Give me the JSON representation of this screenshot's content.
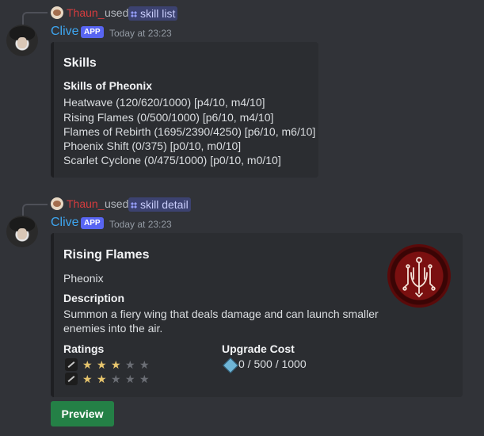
{
  "message1": {
    "reply": {
      "user": "Thaun_",
      "used": "used",
      "command": "skill list"
    },
    "author": "Clive",
    "badge": "APP",
    "timestamp": "Today at 23:23",
    "embed": {
      "title": "Skills",
      "field_name": "Skills of Pheonix",
      "lines": [
        "Heatwave (120/620/1000) [p4/10, m4/10]",
        "Rising Flames (0/500/1000) [p6/10, m4/10]",
        "Flames of Rebirth (1695/2390/4250) [p6/10, m6/10]",
        "Phoenix Shift (0/375) [p0/10, m0/10]",
        "Scarlet Cyclone (0/475/1000) [p0/10, m0/10]"
      ]
    }
  },
  "message2": {
    "reply": {
      "user": "Thaun_",
      "used": "used",
      "command": "skill detail"
    },
    "author": "Clive",
    "badge": "APP",
    "timestamp": "Today at 23:23",
    "embed": {
      "title": "Rising Flames",
      "subtitle": "Pheonix",
      "description_label": "Description",
      "description_lines": [
        "Summon a fiery wing that deals damage and can launch smaller",
        "enemies into the air."
      ],
      "ratings_label": "Ratings",
      "ratings": [
        {
          "icon": "physical-damage-icon",
          "stars": 3,
          "max": 5
        },
        {
          "icon": "magic-damage-icon",
          "stars": 2,
          "max": 5
        }
      ],
      "upgrade_label": "Upgrade Cost",
      "upgrade_value": "0 / 500 / 1000",
      "upgrade_icon": "ability-point-gem-icon"
    },
    "button": "Preview"
  },
  "colors": {
    "background": "#313338",
    "embed": "#2b2d31",
    "username": "#3ea6f0",
    "reply_user": "#d83c3e",
    "app_badge": "#5865f2",
    "button": "#248046",
    "star_on": "#e7c56d"
  }
}
